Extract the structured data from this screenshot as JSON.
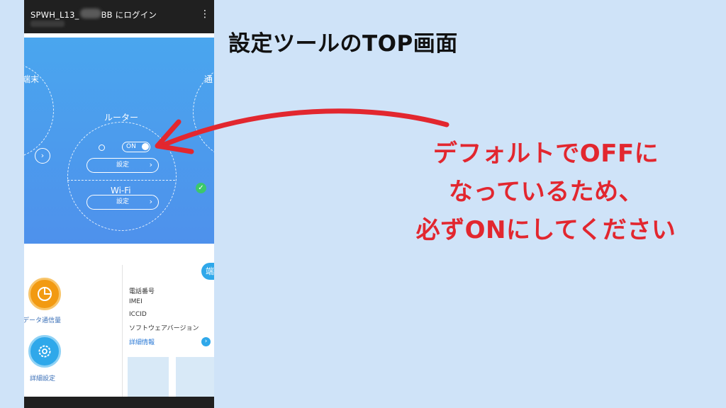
{
  "phone": {
    "title": "SPWH_L13_",
    "title_suffix": "BB にログイン",
    "menu_icon": "vertical-dots-icon"
  },
  "hero": {
    "left_label": "端末",
    "right_label": "通",
    "router_label": "ルーター",
    "toggle_label": "ON",
    "router_settings": "設定",
    "wifi_label": "Wi-Fi",
    "wifi_settings": "設定"
  },
  "lower": {
    "data_usage_label": "データ通信量",
    "advanced_settings_label": "詳細設定",
    "right_tab": "端",
    "info": [
      "電話番号",
      "IMEI",
      "ICCID",
      "ソフトウェアバージョン"
    ],
    "details_link": "詳細情報"
  },
  "annotation": {
    "heading": "設定ツールのTOP画面",
    "callout_lines": [
      "デフォルトでOFFに",
      "なっているため、",
      "必ずONにしてください"
    ],
    "accent_color": "#e2272f"
  }
}
